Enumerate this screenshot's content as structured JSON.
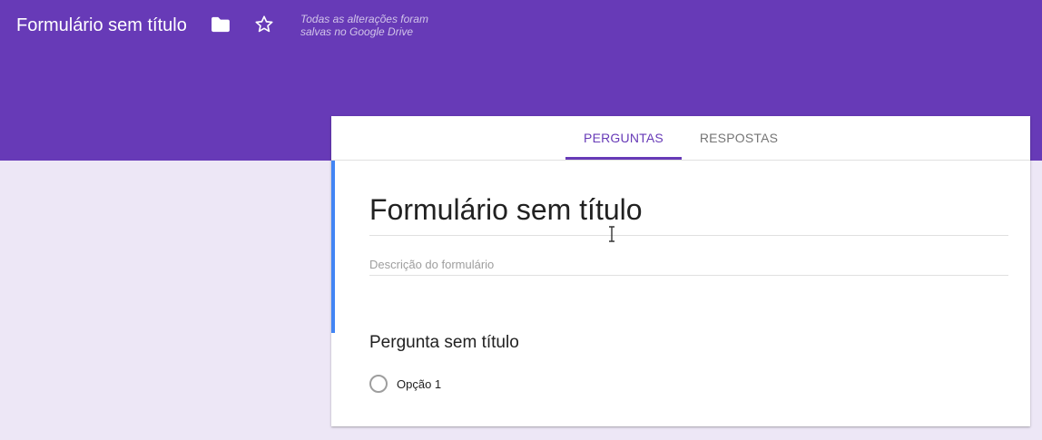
{
  "header": {
    "title": "Formulário sem título",
    "folder_icon": "folder-icon",
    "star_icon": "star-icon",
    "save_status": "Todas as alterações foram salvas no Google Drive"
  },
  "tabs": [
    {
      "label": "PERGUNTAS",
      "active": true
    },
    {
      "label": "RESPOSTAS",
      "active": false
    }
  ],
  "form": {
    "title": "Formulário sem título",
    "description_placeholder": "Descrição do formulário"
  },
  "question": {
    "title": "Pergunta sem título",
    "options": [
      {
        "label": "Opção 1"
      }
    ]
  },
  "colors": {
    "header": "#673ab7",
    "background": "#ede7f6",
    "active_tab": "#673ab7",
    "accent_bar": "#4285f4"
  }
}
